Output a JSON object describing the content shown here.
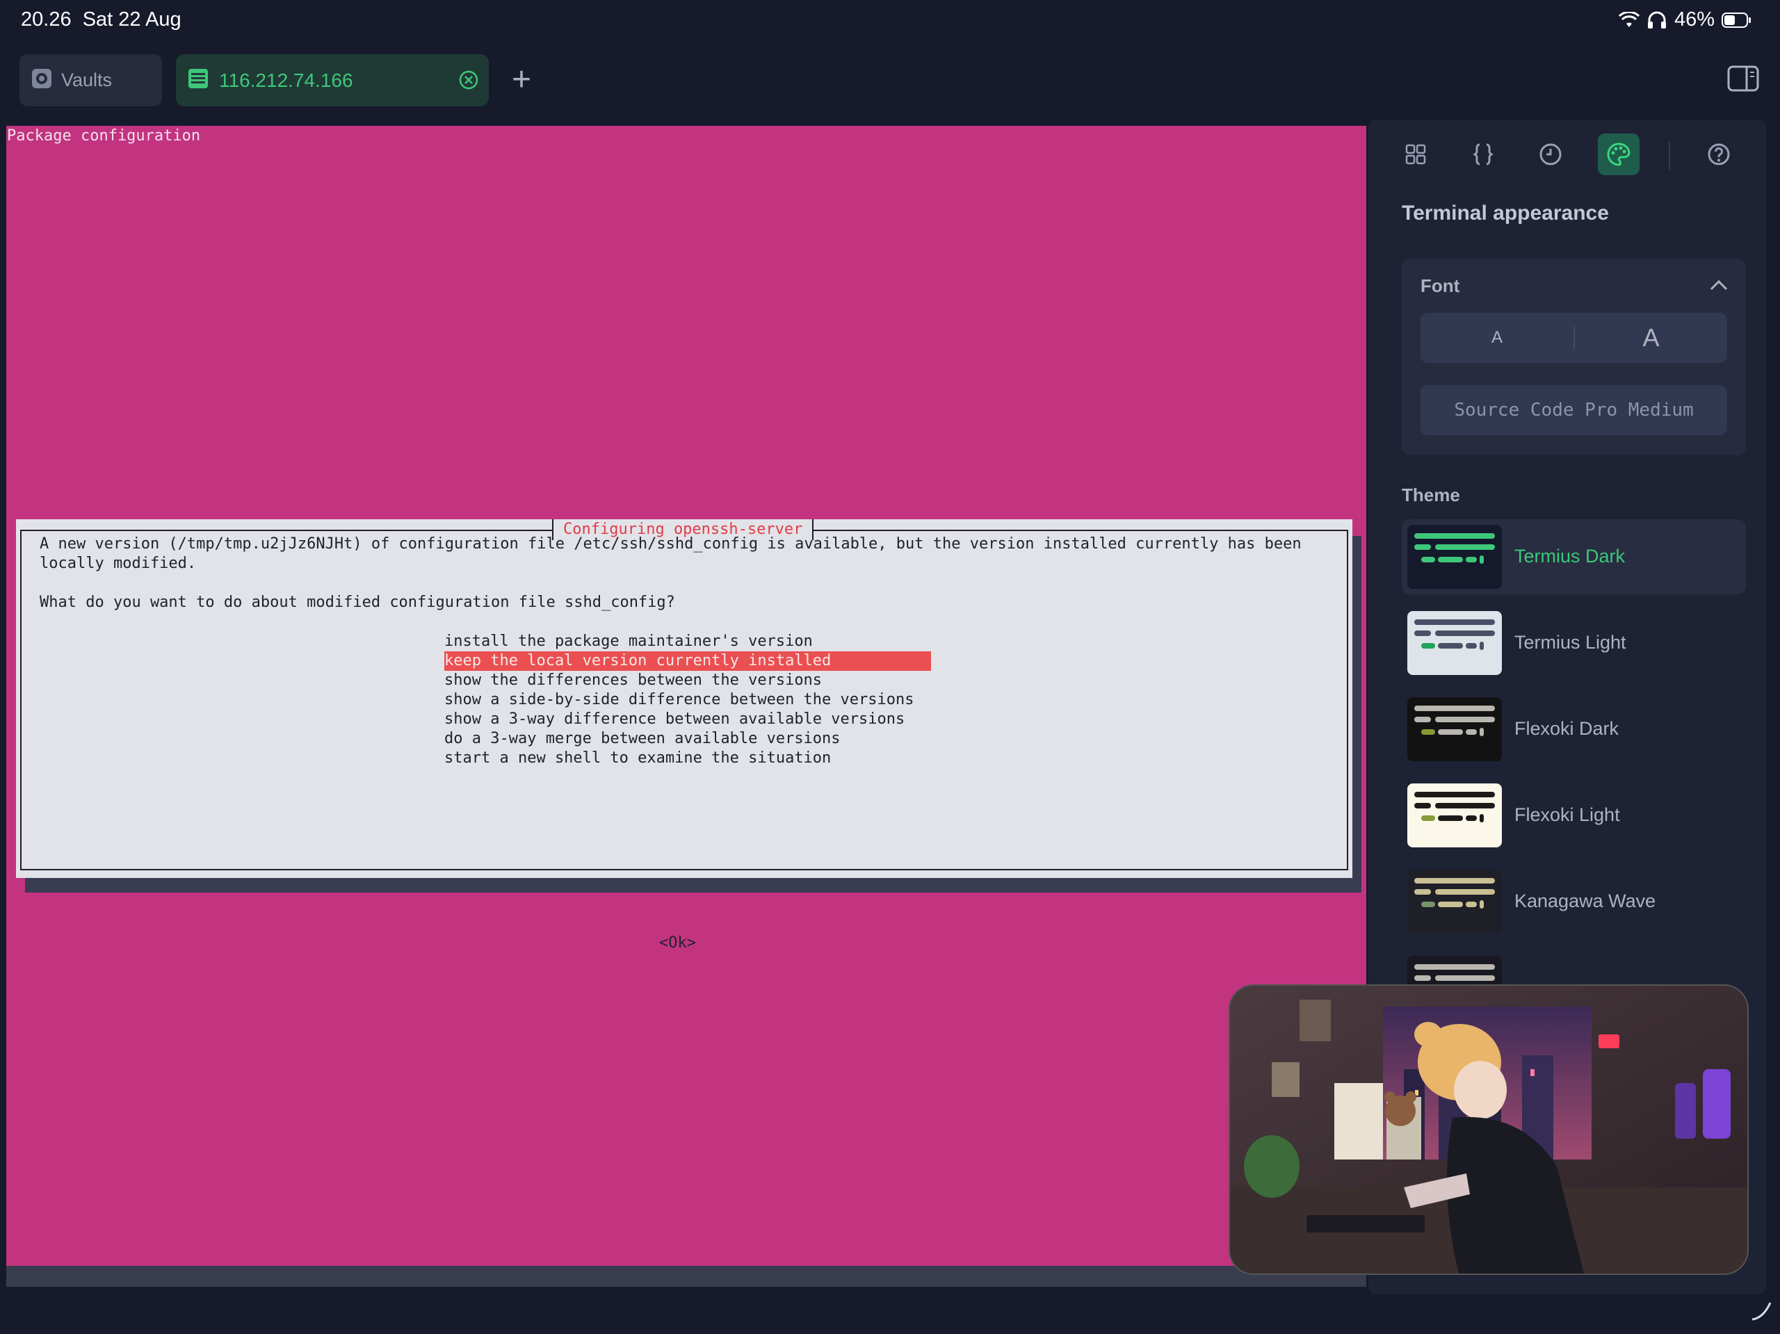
{
  "status_bar": {
    "time": "20.26",
    "date": "Sat 22 Aug",
    "battery": "46%"
  },
  "tabs": {
    "vaults_label": "Vaults",
    "host_label": "116.212.74.166",
    "add_label": "+"
  },
  "terminal": {
    "title": "Package configuration",
    "dialog": {
      "title": "Configuring openssh-server",
      "line1": "A new version (/tmp/tmp.u2jJz6NJHt) of configuration file /etc/ssh/sshd_config is available, but the version installed currently has been",
      "line2": "locally modified.",
      "question": "What do you want to do about modified configuration file sshd_config?",
      "options": [
        "install the package maintainer's version",
        "keep the local version currently installed",
        "show the differences between the versions",
        "show a side-by-side difference between the versions",
        "show a 3-way difference between available versions",
        "do a 3-way merge between available versions",
        "start a new shell to examine the situation"
      ],
      "selected_index": 1,
      "ok_label": "<Ok>"
    }
  },
  "panel": {
    "title": "Terminal appearance",
    "font_section": {
      "label": "Font",
      "size_small": "A",
      "size_large": "A",
      "font_name": "Source Code Pro Medium"
    },
    "theme_section": {
      "label": "Theme",
      "themes": [
        {
          "name": "Termius Dark"
        },
        {
          "name": "Termius Light"
        },
        {
          "name": "Flexoki Dark"
        },
        {
          "name": "Flexoki Light"
        },
        {
          "name": "Kanagawa Wave"
        }
      ],
      "active": "Termius Dark"
    }
  },
  "colors": {
    "terminal_bg": "#c23380",
    "accent_green": "#3ec77a",
    "selected_option": "#ea4f51"
  }
}
